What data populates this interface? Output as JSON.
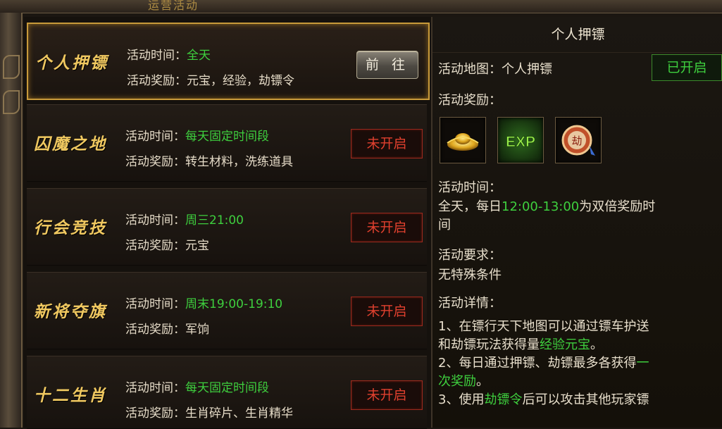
{
  "header": {
    "title_fragment": "运营活动"
  },
  "labels": {
    "time": "活动时间：",
    "reward": "活动奖励："
  },
  "activities": [
    {
      "name": "个人押镖",
      "time": "全天",
      "reward": "元宝，经验，劫镖令",
      "action": "前 往",
      "status": "open"
    },
    {
      "name": "囚魔之地",
      "time": "每天固定时间段",
      "reward": "转生材料，洗练道具",
      "action": "未开启",
      "status": "closed"
    },
    {
      "name": "行会竞技",
      "time": "周三21:00",
      "reward": "元宝",
      "action": "未开启",
      "status": "closed"
    },
    {
      "name": "新将夺旗",
      "time": "周末19:00-19:10",
      "reward": "军饷",
      "action": "未开启",
      "status": "closed"
    },
    {
      "name": "十二生肖",
      "time": "每天固定时间段",
      "reward": "生肖碎片、生肖精华",
      "action": "未开启",
      "status": "closed"
    }
  ],
  "detail": {
    "title": "个人押镖",
    "map_label": "活动地图：",
    "map_value": "个人押镖",
    "status_badge": "已开启",
    "reward_label": "活动奖励：",
    "reward_icons": [
      "gold-ingot-icon",
      "exp-icon",
      "robbery-token-icon"
    ],
    "exp_text": "EXP",
    "token_text": "劫",
    "time_label": "活动时间：",
    "time_prefix": "全天，每日",
    "time_highlight": "12:00-13:00",
    "time_suffix": "为双倍奖励时",
    "time_line2": "间",
    "req_label": "活动要求：",
    "req_value": "无特殊条件",
    "details_label": "活动详情：",
    "d1_a": "1、在镖行天下地图可以通过镖车护送",
    "d1_b": "和劫镖玩法获得量",
    "d1_hl": "经验元宝",
    "d1_end": "。",
    "d2_a": "2、每日通过押镖、劫镖最多各获得",
    "d2_hl1": "一",
    "d2_hl2": "次奖励",
    "d2_end": "。",
    "d3_a": "3、使用",
    "d3_hl": "劫镖令",
    "d3_b": "后可以攻击其他玩家镖"
  },
  "colors": {
    "accent_gold": "#f0c860",
    "green": "#3ecf3e",
    "red": "#e0402e"
  }
}
